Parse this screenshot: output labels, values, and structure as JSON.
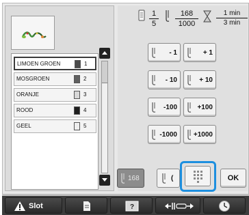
{
  "colors": {
    "highlight": "#1d8fdf",
    "bottom_bar": "#3c3c3c"
  },
  "header": {
    "color_fraction": {
      "current": "1",
      "total": "5"
    },
    "stitch_fraction": {
      "current": "168",
      "total": "1000"
    },
    "time_fraction": {
      "current": "1 min",
      "total": "3 min"
    },
    "icons": [
      "presser-foot-icon",
      "needle-icon",
      "hourglass-icon"
    ]
  },
  "color_list": {
    "items": [
      {
        "name": "LIMOEN GROEN",
        "number": "1",
        "swatch": "#4a4a4a",
        "selected": true
      },
      {
        "name": "MOSGROEN",
        "number": "2",
        "swatch": "#606060",
        "selected": false
      },
      {
        "name": "ORANJE",
        "number": "3",
        "swatch": "#d8d8d8",
        "selected": false
      },
      {
        "name": "ROOD",
        "number": "4",
        "swatch": "#1e1e1e",
        "selected": false
      },
      {
        "name": "GEEL",
        "number": "5",
        "swatch": "#eeeeee",
        "selected": false
      }
    ]
  },
  "stitch_buttons": {
    "minus_1": "- 1",
    "plus_1": "+ 1",
    "minus_10": "- 10",
    "plus_10": "+ 10",
    "minus_100": "-100",
    "plus_100": "+100",
    "minus_1000": "-1000",
    "plus_1000": "+1000"
  },
  "footer_controls": {
    "stitch_counter": "168",
    "needle_partial": "(",
    "ok_label": "OK"
  },
  "bottom_bar": {
    "slot_label": "Slot",
    "icons": [
      "warning-icon",
      "page-icon",
      "help-icon",
      "thread-cutter-icon",
      "clock-icon"
    ]
  }
}
